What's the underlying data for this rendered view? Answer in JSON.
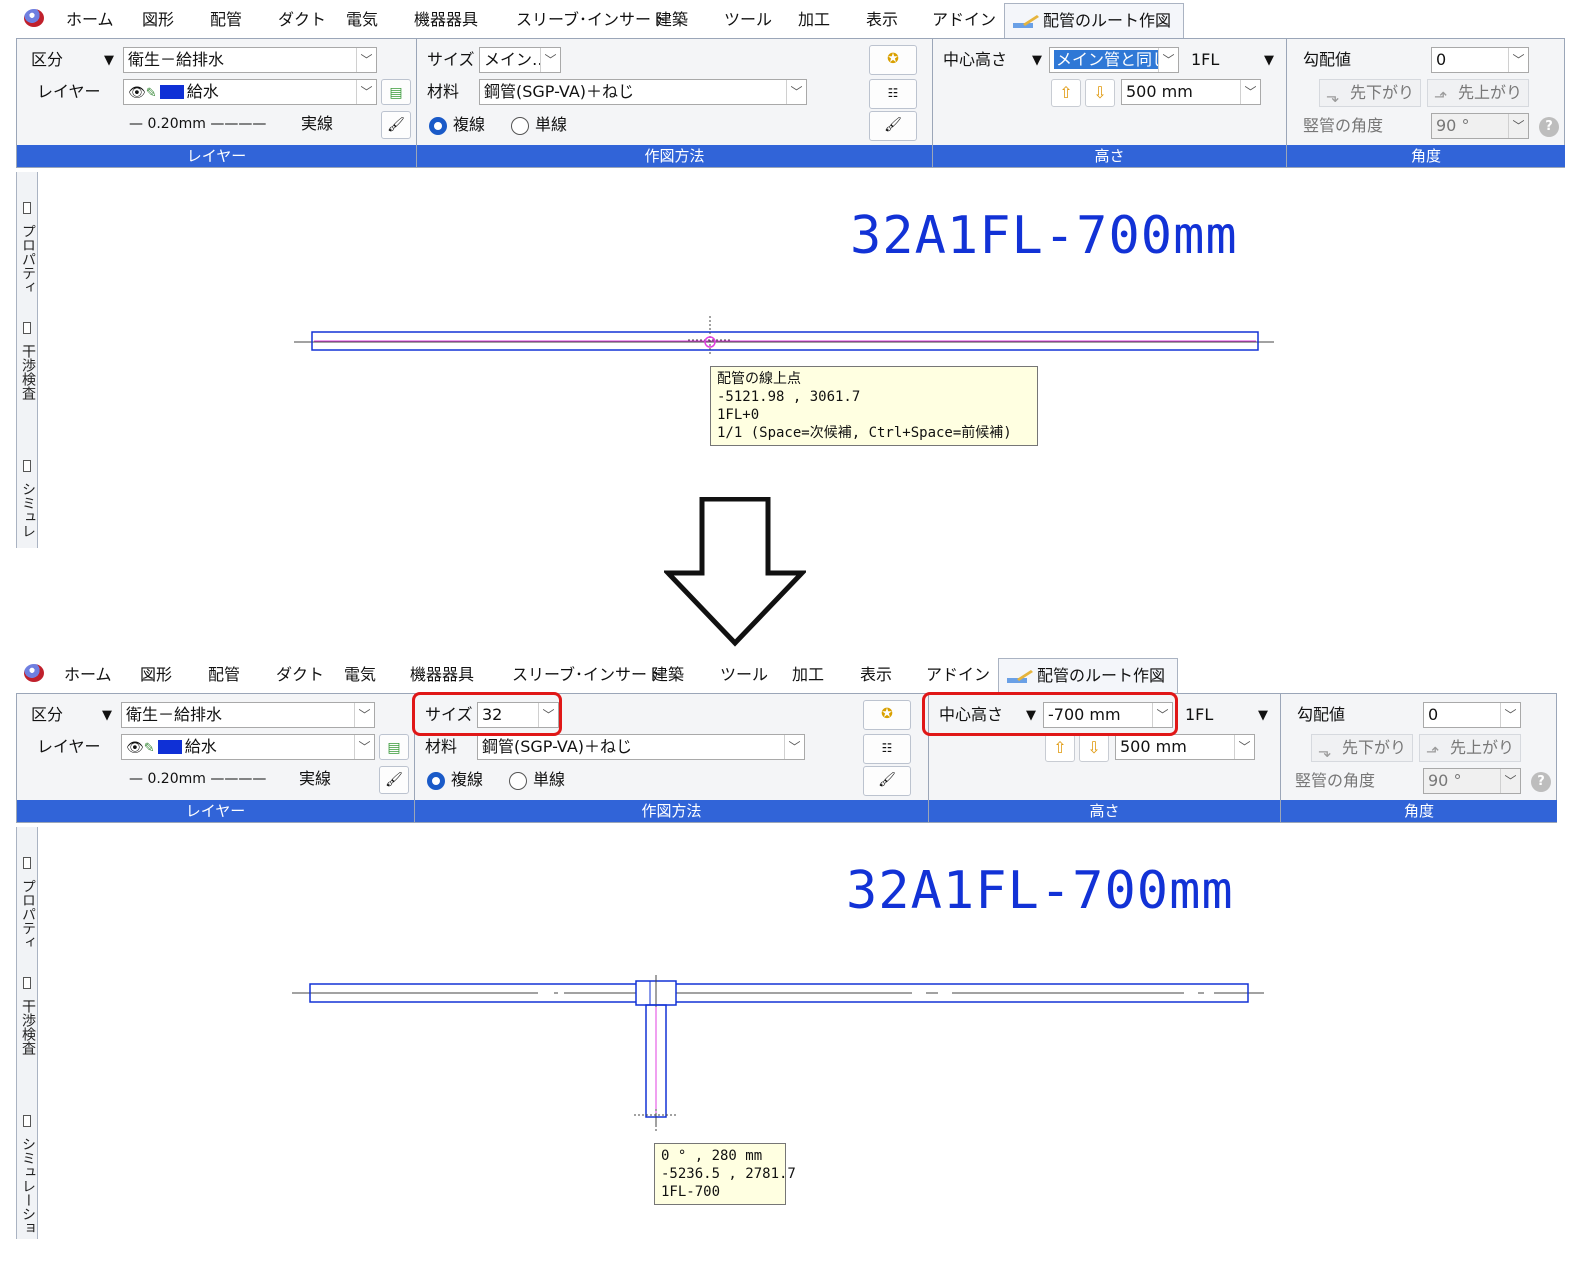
{
  "menu": {
    "items": [
      "ホーム",
      "図形",
      "配管",
      "ダクト",
      "電気",
      "機器器具",
      "スリーブ･インサート",
      "建築",
      "ツール",
      "加工",
      "表示",
      "アドイン"
    ],
    "active_tab": "配管のルート作図"
  },
  "layer_group": {
    "category_label": "区分",
    "category_value": "衛生－給排水",
    "layer_label": "レイヤー",
    "layer_value": "給水",
    "line_width": "0.20mm",
    "line_type": "実線",
    "footer": "レイヤー"
  },
  "draw_group": {
    "size_label": "サイズ",
    "material_label": "材料",
    "material_value": "鋼管(SGP-VA)＋ねじ",
    "radio_double": "複線",
    "radio_single": "単線",
    "footer": "作図方法"
  },
  "height_group": {
    "center_label": "中心高さ",
    "floor": "1FL",
    "step_value": "500 mm",
    "footer": "高さ"
  },
  "angle_group": {
    "slope_label": "勾配値",
    "slope_value": "0",
    "down_button": "先下がり",
    "up_button": "先上がり",
    "vertical_label": "竪管の角度",
    "vertical_value": "90 °",
    "footer": "角度"
  },
  "side_tabs": {
    "property": "プロパティ",
    "interference": "干渉検査",
    "simulation1": "シミュレ",
    "simulation2": "シミュレーション"
  },
  "before": {
    "size_value": "メイン…",
    "center_value": "メイン管と同じ",
    "pipe_label": "32A1FL-700mm",
    "tooltip": [
      "配管の線上点",
      "-5121.98 , 3061.7",
      "1FL+0",
      "1/1 (Space=次候補, Ctrl+Space=前候補)"
    ]
  },
  "after": {
    "size_value": "32",
    "center_value": "-700 mm",
    "pipe_label": "32A1FL-700mm",
    "tooltip": [
      "0 ° , 280 mm",
      "-5236.5 , 2781.7",
      "1FL-700"
    ]
  },
  "colors": {
    "ribbon_footer": "#3164d8",
    "pipe": "#1232d6",
    "pipe_center": "#e040e0",
    "highlight": "#e01717"
  }
}
